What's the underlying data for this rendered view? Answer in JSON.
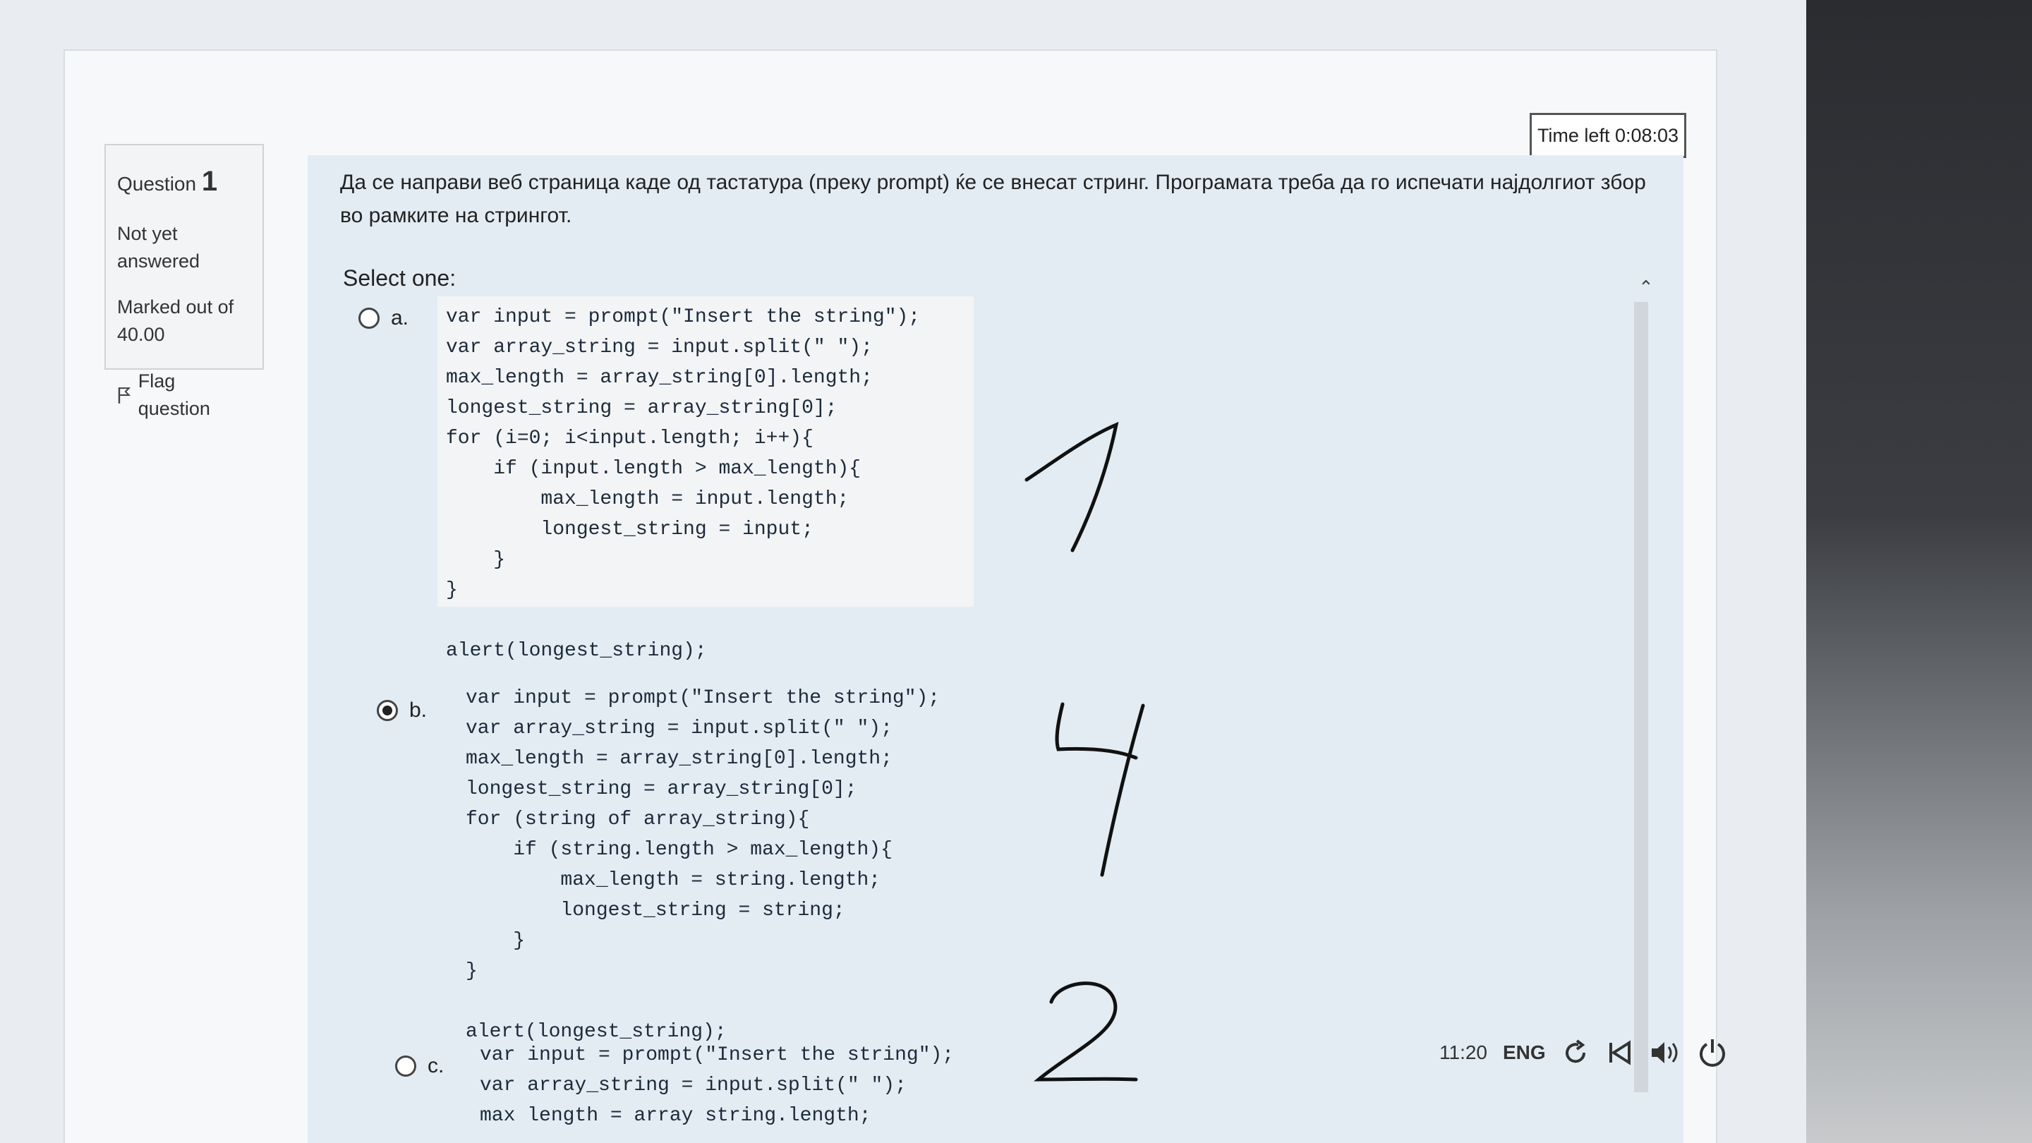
{
  "question_info": {
    "label": "Question",
    "number": "1",
    "status": "Not yet answered",
    "marked_label": "Marked out of",
    "marked_value": "40.00",
    "flag_label": "Flag question"
  },
  "timer": {
    "text": "Time left 0:08:03"
  },
  "question": {
    "text": "Да се направи веб страница каде од тастатура (преку prompt) ќе се внесат стринг. Програмата треба да го испечати најдолгиот збор во рамките на стрингот.",
    "select_label": "Select one:"
  },
  "options": [
    {
      "letter": "a.",
      "selected": false,
      "code": "var input = prompt(\"Insert the string\");\nvar array_string = input.split(\" \");\nmax_length = array_string[0].length;\nlongest_string = array_string[0];\nfor (i=0; i<input.length; i++){\n    if (input.length > max_length){\n        max_length = input.length;\n        longest_string = input;\n    }\n}\n\nalert(longest_string);"
    },
    {
      "letter": "b.",
      "selected": true,
      "code": "var input = prompt(\"Insert the string\");\nvar array_string = input.split(\" \");\nmax_length = array_string[0].length;\nlongest_string = array_string[0];\nfor (string of array_string){\n    if (string.length > max_length){\n        max_length = string.length;\n        longest_string = string;\n    }\n}\n\nalert(longest_string);"
    },
    {
      "letter": "c.",
      "selected": false,
      "code": "var input = prompt(\"Insert the string\");\nvar array_string = input.split(\" \");\nmax length = array string.length;"
    }
  ],
  "handwritten_marks": [
    "1",
    "4",
    "2"
  ],
  "taskbar": {
    "time": "11:20",
    "language": "ENG",
    "icons": [
      "refresh-icon",
      "skip-back-icon",
      "volume-icon",
      "power-icon"
    ]
  }
}
